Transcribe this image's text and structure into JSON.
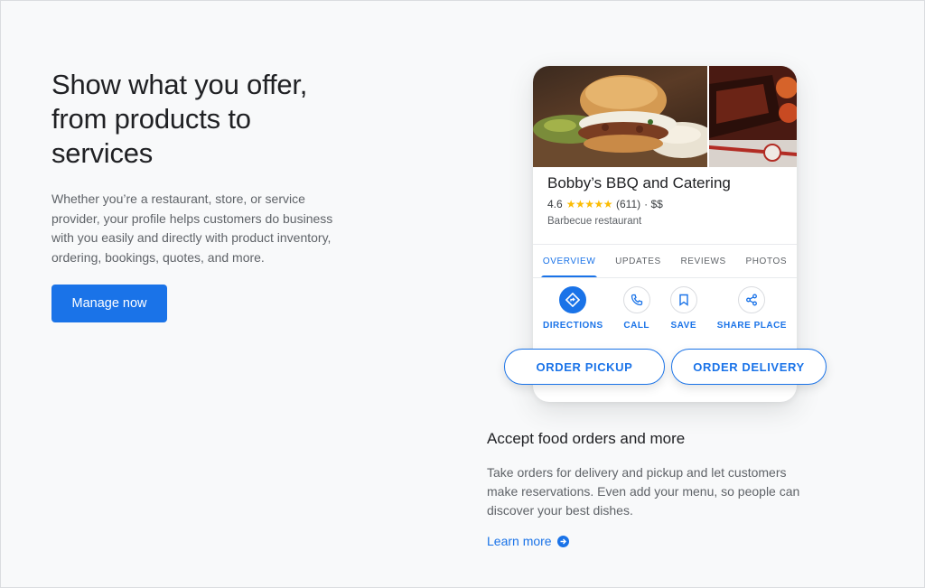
{
  "hero": {
    "title": "Show what you offer, from products to services",
    "body": "Whether you’re a restaurant, store, or service provider, your profile helps customers do business with you easily and directly with product inventory, ordering, bookings, quotes, and more.",
    "cta_label": "Manage now"
  },
  "business_card": {
    "name": "Bobby’s BBQ and Catering",
    "rating": "4.6",
    "stars": "★★★★★",
    "reviews_count": "(611)",
    "price": "· $$",
    "category": "Barbecue restaurant",
    "tabs": [
      {
        "label": "OVERVIEW",
        "active": true
      },
      {
        "label": "UPDATES",
        "active": false
      },
      {
        "label": "REVIEWS",
        "active": false
      },
      {
        "label": "PHOTOS",
        "active": false
      }
    ],
    "actions": [
      {
        "label": "DIRECTIONS",
        "icon": "directions-icon"
      },
      {
        "label": "CALL",
        "icon": "phone-icon"
      },
      {
        "label": "SAVE",
        "icon": "bookmark-icon"
      },
      {
        "label": "SHARE PLACE",
        "icon": "share-icon"
      }
    ],
    "order_pickup_label": "ORDER PICKUP",
    "order_delivery_label": "ORDER DELIVERY"
  },
  "feature": {
    "title": "Accept food orders and more",
    "body": "Take orders for delivery and pickup and let customers make reservations. Even add your menu, so people can discover your best dishes.",
    "link_label": "Learn more"
  },
  "colors": {
    "accent": "#1a73e8",
    "star": "#fbbc04",
    "background": "#f8f9fa"
  }
}
